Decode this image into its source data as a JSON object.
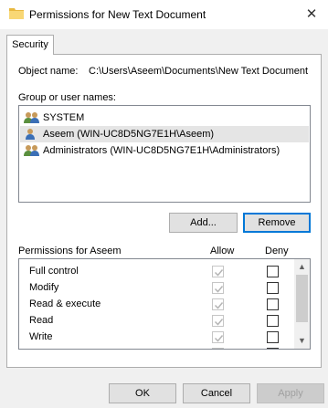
{
  "window": {
    "title": "Permissions for New Text Document",
    "close_glyph": "✕"
  },
  "tabs": [
    {
      "label": "Security"
    }
  ],
  "object": {
    "label": "Object name:",
    "value": "C:\\Users\\Aseem\\Documents\\New Text Document"
  },
  "groups": {
    "label": "Group or user names:",
    "items": [
      {
        "name": "SYSTEM",
        "icon": "group-icon",
        "selected": false
      },
      {
        "name": "Aseem (WIN-UC8D5NG7E1H\\Aseem)",
        "icon": "user-icon",
        "selected": true
      },
      {
        "name": "Administrators (WIN-UC8D5NG7E1H\\Administrators)",
        "icon": "group-icon",
        "selected": false
      }
    ]
  },
  "buttons": {
    "add": "Add...",
    "remove": "Remove",
    "ok": "OK",
    "cancel": "Cancel",
    "apply": "Apply"
  },
  "permissions": {
    "header": "Permissions for Aseem",
    "allow_header": "Allow",
    "deny_header": "Deny",
    "rows": [
      {
        "name": "Full control",
        "allow": true,
        "deny": false
      },
      {
        "name": "Modify",
        "allow": true,
        "deny": false
      },
      {
        "name": "Read & execute",
        "allow": true,
        "deny": false
      },
      {
        "name": "Read",
        "allow": true,
        "deny": false
      },
      {
        "name": "Write",
        "allow": true,
        "deny": false
      }
    ]
  },
  "colors": {
    "accent": "#0078d7",
    "selection": "#e5e5e5",
    "disabled_check": "#b5b5b5"
  }
}
